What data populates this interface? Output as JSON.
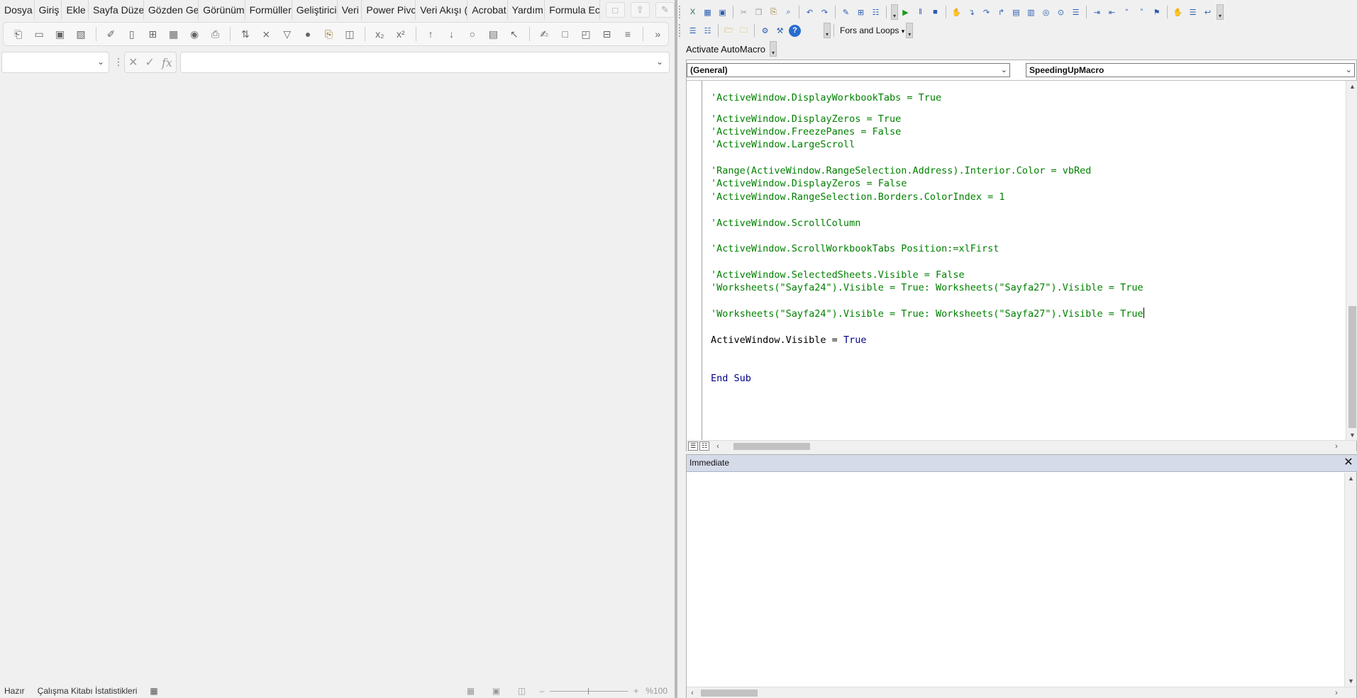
{
  "excel": {
    "menu": [
      "Dosya",
      "Giriş",
      "Ekle",
      "Sayfa Düze",
      "Gözden Ge",
      "Görünüm",
      "Formüller",
      "Geliştirici",
      "Veri",
      "Power Pivc",
      "Veri Akışı (",
      "Acrobat",
      "Yardım",
      "Formula Ec"
    ],
    "menu_buttons": [
      "comment-icon",
      "share-icon",
      "feedback-icon"
    ],
    "toolbar_icons": [
      "open-icon",
      "folder-icon",
      "save-icon",
      "save-as-icon",
      "format-painter-icon",
      "page-icon",
      "grid-icon",
      "table-icon",
      "camera-icon",
      "print-icon",
      "sort-icon",
      "filter-clear-icon",
      "filter-icon",
      "record-icon",
      "paste-icon",
      "freeze-icon",
      "subscript-icon",
      "superscript-icon",
      "sort-asc-icon",
      "sort-desc-icon",
      "shapes-icon",
      "form-icon",
      "select-icon",
      "edit-icon",
      "comment-icon",
      "track-icon",
      "merge-icon",
      "outline-icon",
      "more-icon"
    ],
    "name_box_value": "",
    "formula_value": "",
    "status": {
      "ready": "Hazır",
      "workbook_stats": "Çalışma Kitabı İstatistikleri",
      "zoom": "%100"
    }
  },
  "vbe": {
    "toolbar1_icons": [
      "excel-icon",
      "insert-module-icon",
      "save-icon",
      "cut-icon",
      "copy-icon",
      "paste-icon",
      "find-icon",
      "undo-icon",
      "redo-icon",
      "design-mode-icon",
      "project-explorer-icon",
      "properties-icon",
      "run-icon",
      "break-icon",
      "reset-icon",
      "toggle-breakpoint-icon",
      "step-into-icon",
      "step-over-icon",
      "step-out-icon",
      "locals-icon",
      "immediate-icon",
      "watch-icon",
      "quick-watch-icon",
      "call-stack-icon",
      "indent-icon",
      "outdent-icon",
      "comment-block-icon",
      "uncomment-block-icon",
      "bookmark-icon",
      "hand-icon",
      "list-icon",
      "wrap-icon"
    ],
    "toolbar2": {
      "snippet_label": "Fors and Loops"
    },
    "addin_button": "Activate AutoMacro",
    "object_combo": "(General)",
    "procedure_combo": "SpeedingUpMacro",
    "code_lines": [
      {
        "text": "'ActiveWindow.DisplayWorkbookTabs = True",
        "kind": "comment"
      },
      {
        "text": "'ActiveWindow.DisplayZeros = True",
        "kind": "comment"
      },
      {
        "text": "'ActiveWindow.FreezePanes = False",
        "kind": "comment"
      },
      {
        "text": "'ActiveWindow.LargeScroll",
        "kind": "comment"
      },
      {
        "text": "'Range(ActiveWindow.RangeSelection.Address).Interior.Color = vbRed",
        "kind": "comment"
      },
      {
        "text": "'ActiveWindow.DisplayZeros = False",
        "kind": "comment"
      },
      {
        "text": "'ActiveWindow.RangeSelection.Borders.ColorIndex = 1",
        "kind": "comment"
      },
      {
        "text": "'ActiveWindow.ScrollColumn",
        "kind": "comment"
      },
      {
        "text": "'ActiveWindow.ScrollWorkbookTabs Position:=xlFirst",
        "kind": "comment"
      },
      {
        "text": "'ActiveWindow.SelectedSheets.Visible = False",
        "kind": "comment"
      },
      {
        "text": "'Worksheets(\"Sayfa24\").Visible = True: Worksheets(\"Sayfa27\").Visible = True",
        "kind": "comment"
      },
      {
        "text": "'Worksheets(\"Sayfa24\").Visible = True: Worksheets(\"Sayfa27\").Visible = True",
        "kind": "comment",
        "caret": true
      },
      {
        "text": "ActiveWindow.Visible = ",
        "kind": "code",
        "keyword": "True"
      },
      {
        "text": "End Sub",
        "kind": "keyword"
      }
    ],
    "immediate_title": "Immediate"
  },
  "colors": {
    "comment": "#008000",
    "keyword": "#00008b",
    "immediate_title_bg": "#d6dbe9"
  }
}
